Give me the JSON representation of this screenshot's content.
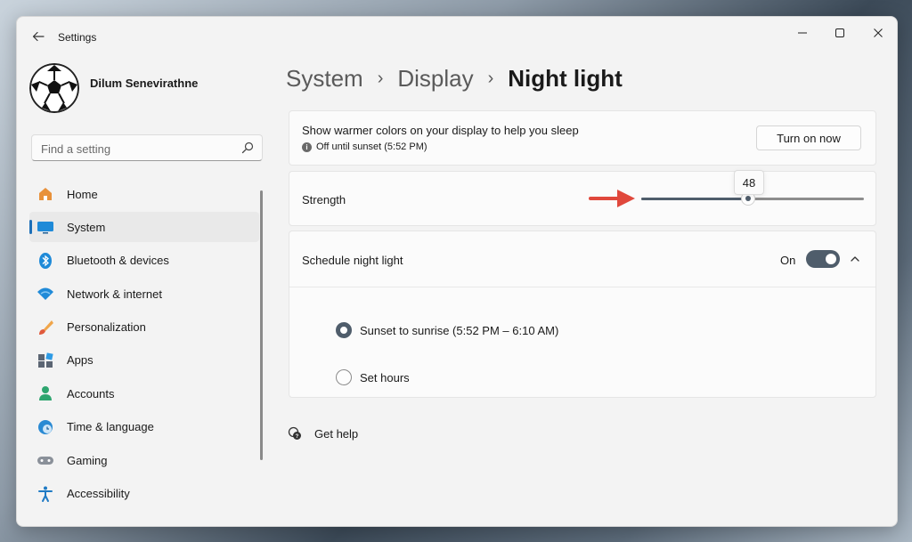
{
  "window": {
    "title": "Settings"
  },
  "user": {
    "name": "Dilum Senevirathne"
  },
  "search": {
    "placeholder": "Find a setting"
  },
  "sidebar": {
    "items": [
      {
        "label": "Home",
        "icon": "home-icon"
      },
      {
        "label": "System",
        "icon": "system-icon",
        "active": true
      },
      {
        "label": "Bluetooth & devices",
        "icon": "bluetooth-icon"
      },
      {
        "label": "Network & internet",
        "icon": "wifi-icon"
      },
      {
        "label": "Personalization",
        "icon": "brush-icon"
      },
      {
        "label": "Apps",
        "icon": "apps-icon"
      },
      {
        "label": "Accounts",
        "icon": "accounts-icon"
      },
      {
        "label": "Time & language",
        "icon": "clock-globe-icon"
      },
      {
        "label": "Gaming",
        "icon": "gamepad-icon"
      },
      {
        "label": "Accessibility",
        "icon": "accessibility-icon"
      }
    ]
  },
  "breadcrumb": {
    "items": [
      "System",
      "Display"
    ],
    "current": "Night light"
  },
  "night_light": {
    "description": "Show warmer colors on your display to help you sleep",
    "status": "Off until sunset (5:52 PM)",
    "turn_on_label": "Turn on now"
  },
  "strength": {
    "label": "Strength",
    "value": 48,
    "value_text": "48",
    "max": 100
  },
  "schedule": {
    "label": "Schedule night light",
    "state_label": "On",
    "enabled": true,
    "options": [
      {
        "label": "Sunset to sunrise (5:52 PM – 6:10 AM)",
        "selected": true
      },
      {
        "label": "Set hours",
        "selected": false
      }
    ]
  },
  "help": {
    "label": "Get help"
  },
  "colors": {
    "accent": "#4f5d6b",
    "arrow": "#e0483c",
    "active_indicator": "#1d6fb8"
  }
}
